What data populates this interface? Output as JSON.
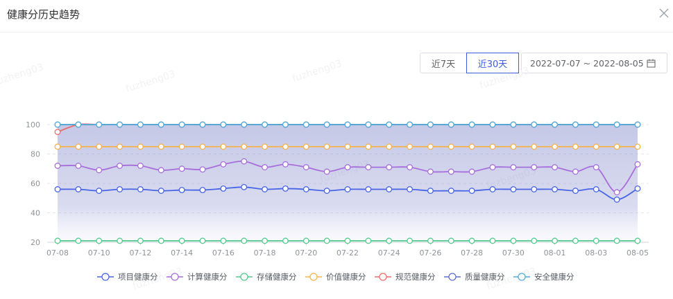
{
  "dialog": {
    "title": "健康分历史趋势"
  },
  "controls": {
    "btn_7": "近7天",
    "btn_30": "近30天",
    "date_range": "2022-07-07 ~ 2022-08-05",
    "selected": "近30天"
  },
  "watermark": "fuzheng03",
  "chart_data": {
    "type": "line",
    "x": [
      "07-08",
      "07-09",
      "07-10",
      "07-11",
      "07-12",
      "07-13",
      "07-14",
      "07-15",
      "07-16",
      "07-17",
      "07-18",
      "07-19",
      "07-20",
      "07-21",
      "07-22",
      "07-23",
      "07-24",
      "07-25",
      "07-26",
      "07-27",
      "07-28",
      "07-29",
      "07-30",
      "07-31",
      "08-01",
      "08-02",
      "08-03",
      "08-04",
      "08-05"
    ],
    "x_tick_labels": [
      "07-08",
      "07-10",
      "07-12",
      "07-14",
      "07-16",
      "07-18",
      "07-20",
      "07-22",
      "07-24",
      "07-26",
      "07-28",
      "07-30",
      "08-01",
      "08-03",
      "08-05"
    ],
    "ylim": [
      20,
      100
    ],
    "y_ticks": [
      20,
      40,
      60,
      80,
      100
    ],
    "grid": true,
    "legend_placement": "bottom-center",
    "series": [
      {
        "name": "项目健康分",
        "color": "#4764e6",
        "values": [
          56,
          56,
          55,
          56,
          56,
          55,
          55.5,
          55.5,
          56.5,
          57.5,
          56,
          56.5,
          56,
          55,
          56,
          56,
          56,
          56,
          55,
          55,
          55,
          56,
          56,
          56,
          56,
          55,
          56,
          49,
          56.5
        ]
      },
      {
        "name": "计算健康分",
        "color": "#a86ddc",
        "values": [
          72,
          72,
          69,
          72,
          72,
          69,
          70,
          69.5,
          73,
          75,
          71,
          73,
          71,
          68,
          71,
          71,
          71,
          71,
          68,
          68,
          68,
          71,
          71,
          71,
          71,
          68,
          71,
          54,
          73
        ]
      },
      {
        "name": "存储健康分",
        "color": "#4fcb8d",
        "values": [
          21,
          21,
          21,
          21,
          21,
          21,
          21,
          21,
          21,
          21,
          21,
          21,
          21,
          21,
          21,
          21,
          21,
          21,
          21,
          21,
          21,
          21,
          21,
          21,
          21,
          21,
          21,
          21,
          21
        ]
      },
      {
        "name": "价值健康分",
        "color": "#f6b24a",
        "values": [
          85,
          85,
          85,
          85,
          85,
          85,
          85,
          85,
          85,
          85,
          85,
          85,
          85,
          85,
          85,
          85,
          85,
          85,
          85,
          85,
          85,
          85,
          85,
          85,
          85,
          85,
          85,
          85,
          85
        ]
      },
      {
        "name": "规范健康分",
        "color": "#eb6b6b",
        "values": [
          95,
          100,
          100,
          100,
          100,
          100,
          100,
          100,
          100,
          100,
          100,
          100,
          100,
          100,
          100,
          100,
          100,
          100,
          100,
          100,
          100,
          100,
          100,
          100,
          100,
          100,
          100,
          100,
          100
        ]
      },
      {
        "name": "质量健康分",
        "color": "#5b6fcc",
        "values": [
          100,
          100,
          100,
          100,
          100,
          100,
          100,
          100,
          100,
          100,
          100,
          100,
          100,
          100,
          100,
          100,
          100,
          100,
          100,
          100,
          100,
          100,
          100,
          100,
          100,
          100,
          100,
          100,
          100
        ]
      },
      {
        "name": "安全健康分",
        "color": "#52acd9",
        "values": [
          100,
          100,
          100,
          100,
          100,
          100,
          100,
          100,
          100,
          100,
          100,
          100,
          100,
          100,
          100,
          100,
          100,
          100,
          100,
          100,
          100,
          100,
          100,
          100,
          100,
          100,
          100,
          100,
          100
        ]
      }
    ]
  }
}
